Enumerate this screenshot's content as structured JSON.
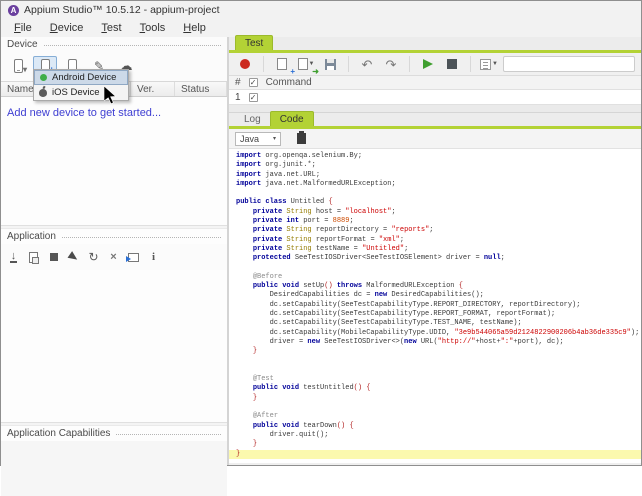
{
  "window": {
    "title": "Appium Studio™ 10.5.12 - appium-project"
  },
  "menu": {
    "items": [
      "File",
      "Device",
      "Test",
      "Tools",
      "Help"
    ]
  },
  "device_panel": {
    "header": "Device",
    "toolbar_icons": [
      "phone-device-icon",
      "add-device-icon",
      "remove-device-icon",
      "edit-device-icon",
      "cloud-device-icon"
    ],
    "columns": {
      "name": "Name",
      "caret": "▼",
      "ver": "Ver.",
      "status": "Status"
    },
    "empty_text": "Add new device to get started...",
    "dropdown": {
      "items": [
        {
          "label": "Android Device",
          "icon": "android-icon"
        },
        {
          "label": "iOS Device",
          "icon": "apple-icon"
        }
      ]
    }
  },
  "application_panel": {
    "header": "Application",
    "toolbar_icons": [
      "install-app-icon",
      "open-app-icon",
      "stop-app-icon",
      "inspect-app-icon",
      "restart-app-icon",
      "close-app-icon",
      "launch-app-icon",
      "app-info-icon"
    ]
  },
  "capabilities_panel": {
    "header": "Application Capabilities"
  },
  "test_panel": {
    "tab_label": "Test",
    "toolbar_icons": [
      "record-icon",
      "new-test-icon",
      "open-test-icon",
      "save-test-icon",
      "undo-icon",
      "redo-icon",
      "run-icon",
      "stop-icon",
      "options-icon"
    ],
    "grid": {
      "col_hash": "#",
      "col_command": "Command",
      "row1_number": "1",
      "checkbox_checked": "✓"
    },
    "tabs": {
      "log": "Log",
      "code": "Code"
    }
  },
  "code": {
    "language": "Java",
    "language_caret": "▾",
    "highlighted_line": 33,
    "lines": [
      [
        {
          "t": "k",
          "s": "import"
        },
        {
          "t": "p",
          "s": " org.openqa.selenium.By;"
        }
      ],
      [
        {
          "t": "k",
          "s": "import"
        },
        {
          "t": "p",
          "s": " org.junit.*;"
        }
      ],
      [
        {
          "t": "k",
          "s": "import"
        },
        {
          "t": "p",
          "s": " java.net.URL;"
        }
      ],
      [
        {
          "t": "k",
          "s": "import"
        },
        {
          "t": "p",
          "s": " java.net.MalformedURLException;"
        }
      ],
      [],
      [
        {
          "t": "k",
          "s": "public class"
        },
        {
          "t": "p",
          "s": " Untitled "
        },
        {
          "t": "b",
          "s": "{"
        }
      ],
      [
        {
          "t": "p",
          "s": "    "
        },
        {
          "t": "k",
          "s": "private"
        },
        {
          "t": "p",
          "s": " "
        },
        {
          "t": "t",
          "s": "String"
        },
        {
          "t": "p",
          "s": " host = "
        },
        {
          "t": "s",
          "s": "\"localhost\""
        },
        {
          "t": "p",
          "s": ";"
        }
      ],
      [
        {
          "t": "p",
          "s": "    "
        },
        {
          "t": "k",
          "s": "private int"
        },
        {
          "t": "p",
          "s": " port = "
        },
        {
          "t": "n",
          "s": "8889"
        },
        {
          "t": "p",
          "s": ";"
        }
      ],
      [
        {
          "t": "p",
          "s": "    "
        },
        {
          "t": "k",
          "s": "private"
        },
        {
          "t": "p",
          "s": " "
        },
        {
          "t": "t",
          "s": "String"
        },
        {
          "t": "p",
          "s": " reportDirectory = "
        },
        {
          "t": "s",
          "s": "\"reports\""
        },
        {
          "t": "p",
          "s": ";"
        }
      ],
      [
        {
          "t": "p",
          "s": "    "
        },
        {
          "t": "k",
          "s": "private"
        },
        {
          "t": "p",
          "s": " "
        },
        {
          "t": "t",
          "s": "String"
        },
        {
          "t": "p",
          "s": " reportFormat = "
        },
        {
          "t": "s",
          "s": "\"xml\""
        },
        {
          "t": "p",
          "s": ";"
        }
      ],
      [
        {
          "t": "p",
          "s": "    "
        },
        {
          "t": "k",
          "s": "private"
        },
        {
          "t": "p",
          "s": " "
        },
        {
          "t": "t",
          "s": "String"
        },
        {
          "t": "p",
          "s": " testName = "
        },
        {
          "t": "s",
          "s": "\"Untitled\""
        },
        {
          "t": "p",
          "s": ";"
        }
      ],
      [
        {
          "t": "p",
          "s": "    "
        },
        {
          "t": "k",
          "s": "protected"
        },
        {
          "t": "p",
          "s": " SeeTestIOSDriver<SeeTestIOSElement> driver = "
        },
        {
          "t": "k",
          "s": "null"
        },
        {
          "t": "p",
          "s": ";"
        }
      ],
      [],
      [
        {
          "t": "p",
          "s": "    "
        },
        {
          "t": "a",
          "s": "@Before"
        }
      ],
      [
        {
          "t": "p",
          "s": "    "
        },
        {
          "t": "k",
          "s": "public void"
        },
        {
          "t": "p",
          "s": " setUp"
        },
        {
          "t": "b",
          "s": "()"
        },
        {
          "t": "p",
          "s": " "
        },
        {
          "t": "k",
          "s": "throws"
        },
        {
          "t": "p",
          "s": " MalformedURLException "
        },
        {
          "t": "b",
          "s": "{"
        }
      ],
      [
        {
          "t": "p",
          "s": "        DesiredCapabilities dc = "
        },
        {
          "t": "k",
          "s": "new"
        },
        {
          "t": "p",
          "s": " DesiredCapabilities();"
        }
      ],
      [
        {
          "t": "p",
          "s": "        dc.setCapability(SeeTestCapabilityType.REPORT_DIRECTORY, reportDirectory);"
        }
      ],
      [
        {
          "t": "p",
          "s": "        dc.setCapability(SeeTestCapabilityType.REPORT_FORMAT, reportFormat);"
        }
      ],
      [
        {
          "t": "p",
          "s": "        dc.setCapability(SeeTestCapabilityType.TEST_NAME, testName);"
        }
      ],
      [
        {
          "t": "p",
          "s": "        dc.setCapability(MobileCapabilityType.UDID, "
        },
        {
          "t": "s",
          "s": "\"3e9b544065a59d2124822900206b4ab36de335c9\""
        },
        {
          "t": "p",
          "s": ");"
        }
      ],
      [
        {
          "t": "p",
          "s": "        driver = "
        },
        {
          "t": "k",
          "s": "new"
        },
        {
          "t": "p",
          "s": " SeeTestIOSDriver<>("
        },
        {
          "t": "k",
          "s": "new"
        },
        {
          "t": "p",
          "s": " URL("
        },
        {
          "t": "s",
          "s": "\"http://\""
        },
        {
          "t": "p",
          "s": "+host+"
        },
        {
          "t": "s",
          "s": "\":\""
        },
        {
          "t": "p",
          "s": "+port), dc);"
        }
      ],
      [
        {
          "t": "p",
          "s": "    "
        },
        {
          "t": "b",
          "s": "}"
        }
      ],
      [],
      [],
      [
        {
          "t": "p",
          "s": "    "
        },
        {
          "t": "a",
          "s": "@Test"
        }
      ],
      [
        {
          "t": "p",
          "s": "    "
        },
        {
          "t": "k",
          "s": "public void"
        },
        {
          "t": "p",
          "s": " testUntitled"
        },
        {
          "t": "b",
          "s": "()"
        },
        {
          "t": "p",
          "s": " "
        },
        {
          "t": "b",
          "s": "{"
        }
      ],
      [
        {
          "t": "p",
          "s": "    "
        },
        {
          "t": "b",
          "s": "}"
        }
      ],
      [],
      [
        {
          "t": "p",
          "s": "    "
        },
        {
          "t": "a",
          "s": "@After"
        }
      ],
      [
        {
          "t": "p",
          "s": "    "
        },
        {
          "t": "k",
          "s": "public void"
        },
        {
          "t": "p",
          "s": " tearDown"
        },
        {
          "t": "b",
          "s": "()"
        },
        {
          "t": "p",
          "s": " "
        },
        {
          "t": "b",
          "s": "{"
        }
      ],
      [
        {
          "t": "p",
          "s": "        driver.quit();"
        }
      ],
      [
        {
          "t": "p",
          "s": "    "
        },
        {
          "t": "b",
          "s": "}"
        }
      ],
      [
        {
          "t": "b",
          "s": "}"
        }
      ]
    ]
  },
  "colors": {
    "accent_green": "#b3d235",
    "record_red": "#cc2a1f",
    "run_green": "#3f9f2f",
    "link_blue": "#3e3ed2",
    "keyword_navy": "#000099",
    "string_red": "#cc0000",
    "type_olive": "#947b00",
    "annotation_gray": "#8a8a8a",
    "number_red": "#cc4b00",
    "bracket_red": "#b22222",
    "current_line_yellow": "#fbf9ae"
  }
}
